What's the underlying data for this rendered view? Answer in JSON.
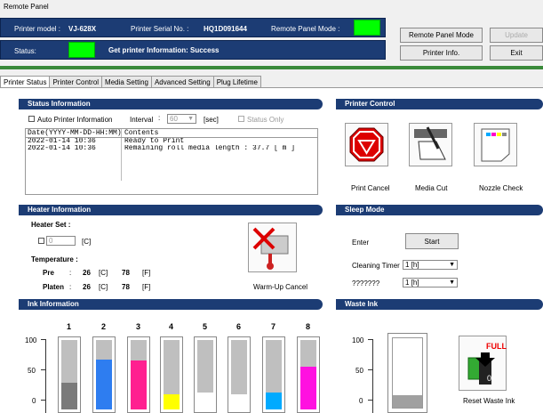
{
  "window": {
    "title": "Remote Panel"
  },
  "header": {
    "model_label": "Printer model :",
    "model_value": "VJ-628X",
    "serial_label": "Printer Serial No. :",
    "serial_value": "HQ1D091644",
    "mode_label": "Remote Panel Mode :",
    "status_label": "Status:",
    "status_text": "Get printer Information: Success",
    "buttons": {
      "remote_panel_mode": "Remote Panel Mode",
      "update": "Update",
      "printer_info": "Printer Info.",
      "exit": "Exit"
    }
  },
  "tabs": [
    {
      "label": "Printer Status",
      "active": true
    },
    {
      "label": "Printer Control"
    },
    {
      "label": "Media Setting"
    },
    {
      "label": "Advanced Setting"
    },
    {
      "label": "Plug Lifetime"
    }
  ],
  "status_info": {
    "title": "Status Information",
    "auto_label": "Auto Printer Information",
    "interval_label": "Interval",
    "interval_value": "60",
    "interval_unit": "[sec]",
    "status_only": "Status Only",
    "col_date": "Date(YYYY-MM-DD-HH:MM)",
    "col_contents": "Contents",
    "rows": [
      {
        "date": "2022-01-14 10:36",
        "content": "Ready to Print"
      },
      {
        "date": "2022-01-14 10:36",
        "content": " Remaining roll media length :  37.7 [ m ]"
      }
    ]
  },
  "printer_control": {
    "title": "Printer Control",
    "print_cancel": "Print Cancel",
    "media_cut": "Media Cut",
    "nozzle_check": "Nozzle Check"
  },
  "heater": {
    "title": "Heater Information",
    "heater_set": "Heater Set :",
    "set_value": "0",
    "set_unit": "[C]",
    "temperature": "Temperature :",
    "pre_label": "Pre",
    "pre_c": "26",
    "pre_f": "78",
    "platen_label": "Platen",
    "platen_c": "26",
    "platen_f": "78",
    "unit_c": "[C]",
    "unit_f": "[F]",
    "colon": ":",
    "warmup_cancel": "Warm-Up Cancel"
  },
  "sleep": {
    "title": "Sleep Mode",
    "enter_label": "Enter",
    "start_button": "Start",
    "cleaning_label": "Cleaning Timer",
    "cleaning_value": "1 [h]",
    "unknown_label": "???????",
    "unknown_value": "1 [h]"
  },
  "ink": {
    "title": "Ink Information",
    "scale": [
      "100",
      "50",
      "0"
    ],
    "channels": [
      {
        "n": "1",
        "level": 0.38,
        "color": "#7a7a7a"
      },
      {
        "n": "2",
        "level": 0.72,
        "color": "#2e7df0"
      },
      {
        "n": "3",
        "level": 0.7,
        "color": "#ff2090"
      },
      {
        "n": "4",
        "level": 0.22,
        "color": "#ffff00"
      },
      {
        "n": "5",
        "level": 0.25,
        "color": "#ffffff"
      },
      {
        "n": "6",
        "level": 0.22,
        "color": "#ffffff"
      },
      {
        "n": "7",
        "level": 0.25,
        "color": "#00aaff"
      },
      {
        "n": "8",
        "level": 0.62,
        "color": "#ff10e0"
      }
    ]
  },
  "waste": {
    "title": "Waste Ink",
    "scale": [
      "100",
      "50",
      "0"
    ],
    "level": 0.18,
    "full_label": "FULL",
    "reset_button": "Reset Waste Ink"
  }
}
